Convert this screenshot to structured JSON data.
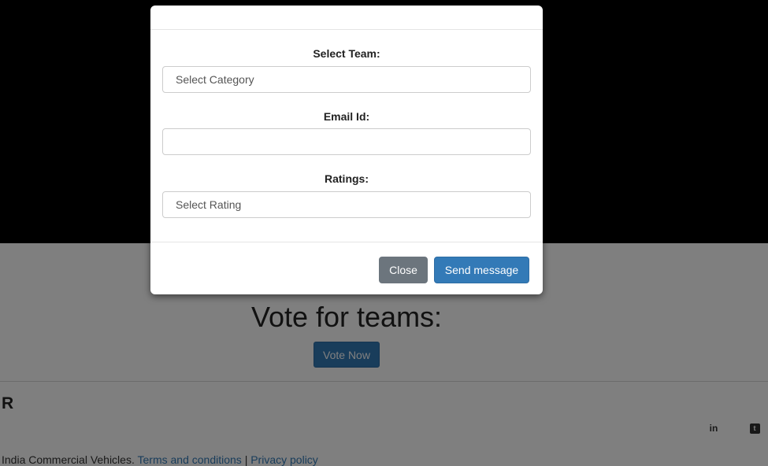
{
  "page": {
    "vote_heading": "Vote for teams:",
    "vote_button": "Vote Now",
    "footer_brand": "R",
    "copyright_text": "India Commercial Vehicles.",
    "terms_link": "Terms and conditions",
    "separator": "|",
    "privacy_link": "Privacy policy",
    "social": {
      "linkedin_glyph": "in",
      "twitter_glyph": "t"
    }
  },
  "modal": {
    "team_label": "Select Team:",
    "team_select_value": "Select Category",
    "email_label": "Email Id:",
    "email_value": "",
    "ratings_label": "Ratings:",
    "ratings_select_value": "Select Rating",
    "close_button": "Close",
    "send_button": "Send message"
  },
  "colors": {
    "primary": "#337ab7",
    "secondary": "#6c757d",
    "hero_background": "#000000"
  },
  "icons": [
    "linkedin-icon",
    "twitter-icon"
  ]
}
